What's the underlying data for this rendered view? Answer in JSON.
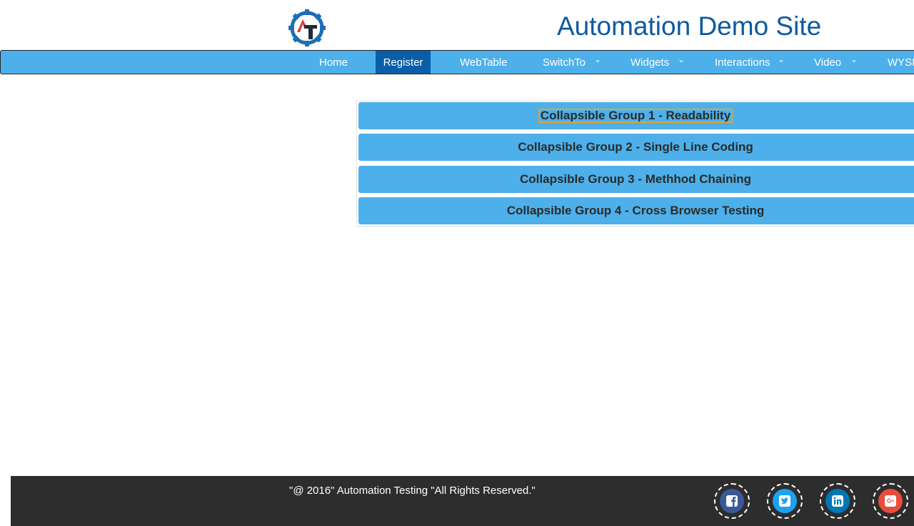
{
  "header": {
    "site_title": "Automation Demo Site"
  },
  "nav": {
    "items": [
      {
        "label": "Home"
      },
      {
        "label": "Register"
      },
      {
        "label": "WebTable"
      },
      {
        "label": "SwitchTo"
      },
      {
        "label": "Widgets"
      },
      {
        "label": "Interactions"
      },
      {
        "label": "Video"
      },
      {
        "label": "WYSIWYG"
      }
    ],
    "active": "Register",
    "chevron": "⌄"
  },
  "accordion": {
    "groups": [
      {
        "title": "Collapsible Group 1 - Readability"
      },
      {
        "title": "Collapsible Group 2 - Single Line Coding"
      },
      {
        "title": "Collapsible Group 3 - Methhod Chaining"
      },
      {
        "title": "Collapsible Group 4 - Cross Browser Testing"
      }
    ]
  },
  "footer": {
    "copyright": "\"@ 2016\" Automation Testing \"All Rights Reserved.\"",
    "social": [
      {
        "icon": "facebook-icon",
        "color": "#3b5998"
      },
      {
        "icon": "twitter-icon",
        "color": "#1da1f2"
      },
      {
        "icon": "linkedin-icon",
        "color": "#0077b5"
      },
      {
        "icon": "google-plus-icon",
        "color": "#ea4c3c"
      }
    ]
  },
  "colors": {
    "nav_bg": "#4db0ea",
    "nav_active": "#0a5ea8",
    "title": "#0d5aa0",
    "footer_bg": "#2d2d2d"
  }
}
